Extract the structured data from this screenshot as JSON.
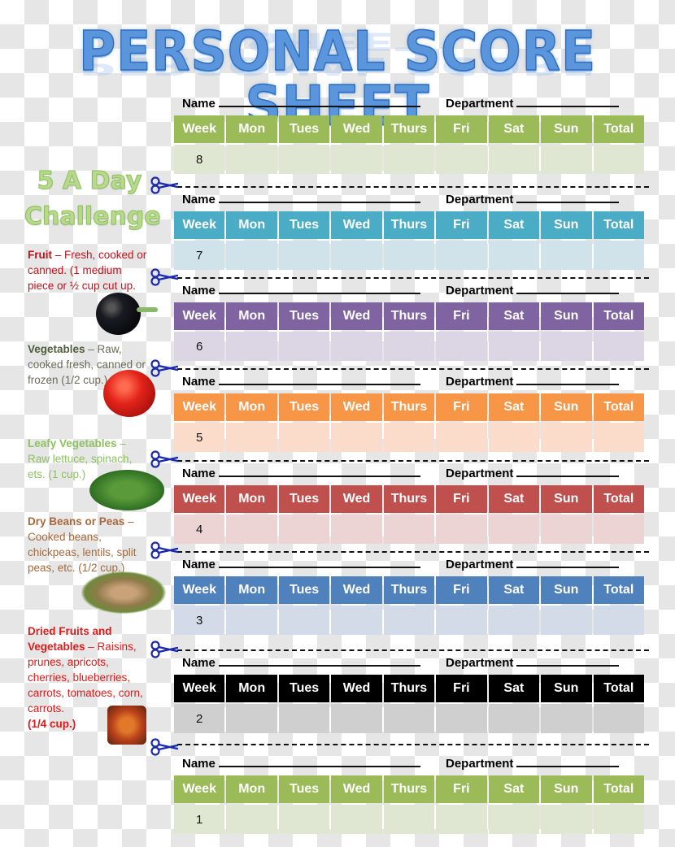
{
  "title": "PERSONAL SCORE SHEET",
  "challenge": {
    "line1": "5 A Day",
    "line2": "Challenge"
  },
  "form": {
    "name_label": "Name",
    "department_label": "Department"
  },
  "columns": [
    "Week",
    "Mon",
    "Tues",
    "Wed",
    "Thurs",
    "Fri",
    "Sat",
    "Sun",
    "Total"
  ],
  "weeks": [
    {
      "week": "8",
      "header_color": "#9bbb59",
      "row_color": "#dfe7d2"
    },
    {
      "week": "7",
      "header_color": "#4bacc6",
      "row_color": "#d0e3ea"
    },
    {
      "week": "6",
      "header_color": "#8064a2",
      "row_color": "#dcd5e4"
    },
    {
      "week": "5",
      "header_color": "#f79646",
      "row_color": "#fbdccb"
    },
    {
      "week": "4",
      "header_color": "#c0504d",
      "row_color": "#ecd4d4"
    },
    {
      "week": "3",
      "header_color": "#4f81bd",
      "row_color": "#d3dbe9"
    },
    {
      "week": "2",
      "header_color": "#000000",
      "row_color": "#cfcfcf"
    },
    {
      "week": "1",
      "header_color": "#9bbb59",
      "row_color": "#dfe7d2"
    }
  ],
  "legend": [
    {
      "heading": "Fruit",
      "text": " – Fresh, cooked or canned. (1 medium piece or ½ cup cut up.",
      "color": "#c0121b",
      "image": "blackberry"
    },
    {
      "heading": "Vegetables",
      "text": " – Raw, cooked fresh, canned or frozen (1/2 cup.)",
      "color": "#4f5f3a",
      "image": "tomato"
    },
    {
      "heading": "Leafy Vegetables",
      "text": " – Raw lettuce, spinach, ets. (1 cup.)",
      "color": "#8cc060",
      "image": "spinach"
    },
    {
      "heading": "Dry Beans or Peas",
      "text": " – Cooked beans, chickpeas, lentils, split peas, etc. (1/2 cup.)",
      "color": "#a8683a",
      "image": "beans"
    },
    {
      "heading": "Dried Fruits and Vegetables",
      "text": " – Raisins, prunes, apricots, cherries, blueberries, carrots, tomatoes, corn, carrots.",
      "suffix": "(1/4 cup.)",
      "color": "#e01919",
      "image": "dried-tomatoes"
    }
  ],
  "icons": {
    "cut_marker": "scissors-icon"
  }
}
